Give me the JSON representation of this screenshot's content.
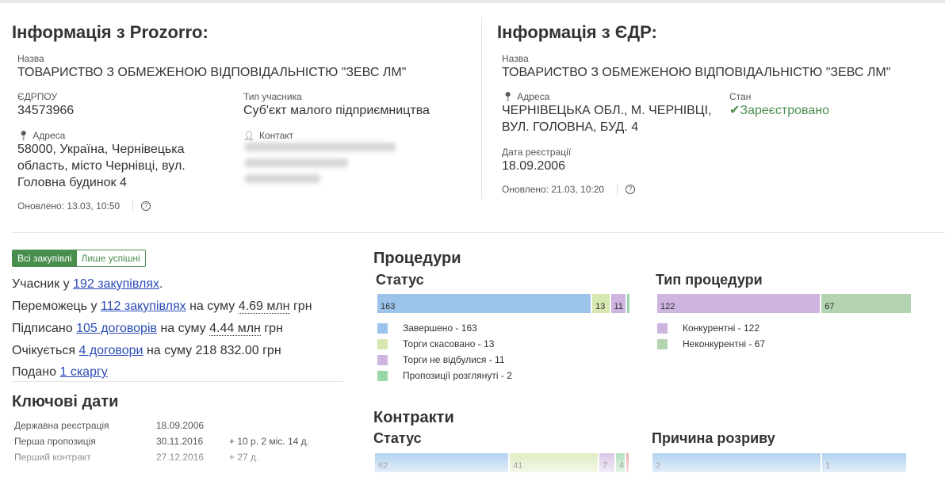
{
  "colors": {
    "accent_green": "#4a8e4d",
    "link_blue": "#2a4bb5",
    "bar_blue": "#9bc3eb",
    "bar_lightgreen": "#d6e7b0",
    "bar_purple": "#cdb5df",
    "bar_green": "#9ad7a8",
    "bar_sage": "#b4d3b1",
    "bar_red": "#e58a8a"
  },
  "prozorro": {
    "title": "Інформація з Prozorro:",
    "name_label": "Назва",
    "name_value": "ТОВАРИСТВО З ОБМЕЖЕНОЮ ВІДПОВІДАЛЬНІСТЮ \"ЗЕВС ЛМ\"",
    "edrpou_label": "ЄДРПОУ",
    "edrpou_value": "34573966",
    "type_label": "Тип учасника",
    "type_value": "Суб'єкт малого підприємництва",
    "address_label": "Адреса",
    "address_line1": "58000, Україна, Чернівецька",
    "address_line2": "область, місто Чернівці, вул.",
    "address_line3": "Головна будинок 4",
    "contact_label": "Контакт",
    "updated": "Оновлено: 13.03, 10:50"
  },
  "edr": {
    "title": "Інформація з ЄДР:",
    "name_label": "Назва",
    "name_value": "ТОВАРИСТВО З ОБМЕЖЕНОЮ ВІДПОВІДАЛЬНІСТЮ \"ЗЕВС ЛМ\"",
    "address_label": "Адреса",
    "address_line1": "ЧЕРНІВЕЦЬКА ОБЛ., М. ЧЕРНІВЦІ,",
    "address_line2": "ВУЛ. ГОЛОВНА, БУД. 4",
    "state_label": "Стан",
    "state_value": "Зареєстровано",
    "reg_date_label": "Дата реєстрації",
    "reg_date_value": "18.09.2006",
    "updated": "Оновлено: 21.03, 10:20"
  },
  "filters": {
    "all": "Всі закупівлі",
    "success": "Лише успішні"
  },
  "stats": {
    "participant_prefix": "Учасник у",
    "participant_link": "192 закупівлях",
    "participant_suffix": ".",
    "winner_prefix": "Переможець у",
    "winner_link": "112 закупівлях",
    "winner_mid": "на суму",
    "winner_amount": "4.69 млн",
    "winner_currency": "грн",
    "signed_prefix": "Підписано",
    "signed_link": "105 договорів",
    "signed_mid": "на суму",
    "signed_amount": "4.44 млн",
    "signed_currency": "грн",
    "expected_prefix": "Очікується",
    "expected_link": "4 договори",
    "expected_mid": "на суму 218 832.00 грн",
    "submitted_prefix": "Подано",
    "submitted_link": "1 скаргу"
  },
  "key_dates": {
    "title": "Ключові дати",
    "rows": [
      {
        "label": "Державна реєстрація",
        "date": "18.09.2006",
        "delta": ""
      },
      {
        "label": "Перша пропозиція",
        "date": "30.11.2016",
        "delta": "+ 10 р. 2 міс. 14 д."
      },
      {
        "label": "Перший контракт",
        "date": "27.12.2016",
        "delta": "+ 27 д."
      }
    ]
  },
  "procedures": {
    "title": "Процедури",
    "status_title": "Статус",
    "type_title": "Тип процедури",
    "status_legend": [
      "Завершено - 163",
      "Торги скасовано - 13",
      "Торги не відбулися - 11",
      "Пропозиції розглянуті - 2"
    ],
    "type_legend": [
      "Конкурентні - 122",
      "Неконкурентні - 67"
    ]
  },
  "contracts": {
    "title": "Контракти",
    "status_title": "Статус",
    "break_title": "Причина розриву"
  },
  "chart_data": [
    {
      "type": "bar",
      "title": "Статус",
      "stacked": true,
      "series": [
        {
          "name": "Завершено",
          "values": [
            163
          ],
          "label": "163",
          "color": "#9bc3eb"
        },
        {
          "name": "Торги скасовано",
          "values": [
            13
          ],
          "label": "13",
          "color": "#d6e7b0"
        },
        {
          "name": "Торги не відбулися",
          "values": [
            11
          ],
          "label": "11",
          "color": "#cdb5df"
        },
        {
          "name": "Пропозиції розглянуті",
          "values": [
            2
          ],
          "label": "",
          "color": "#9ad7a8"
        }
      ]
    },
    {
      "type": "bar",
      "title": "Тип процедури",
      "stacked": true,
      "series": [
        {
          "name": "Конкурентні",
          "values": [
            122
          ],
          "label": "122",
          "color": "#cdb5df"
        },
        {
          "name": "Неконкурентні",
          "values": [
            67
          ],
          "label": "67",
          "color": "#b4d3b1"
        }
      ]
    },
    {
      "type": "bar",
      "title": "Статус",
      "stacked": true,
      "series": [
        {
          "values": [
            62
          ],
          "label": "62",
          "color": "#9bc3eb"
        },
        {
          "values": [
            41
          ],
          "label": "41",
          "color": "#d6e7b0"
        },
        {
          "values": [
            7
          ],
          "label": "7",
          "color": "#cdb5df"
        },
        {
          "values": [
            4
          ],
          "label": "4",
          "color": "#9ad7a8"
        },
        {
          "values": [
            1
          ],
          "label": "",
          "color": "#e58a8a"
        }
      ]
    },
    {
      "type": "bar",
      "title": "Причина розриву",
      "stacked": true,
      "series": [
        {
          "values": [
            2
          ],
          "label": "2",
          "color": "#9bc3eb"
        },
        {
          "values": [
            1
          ],
          "label": "1",
          "color": "#9bc3eb"
        }
      ]
    }
  ]
}
